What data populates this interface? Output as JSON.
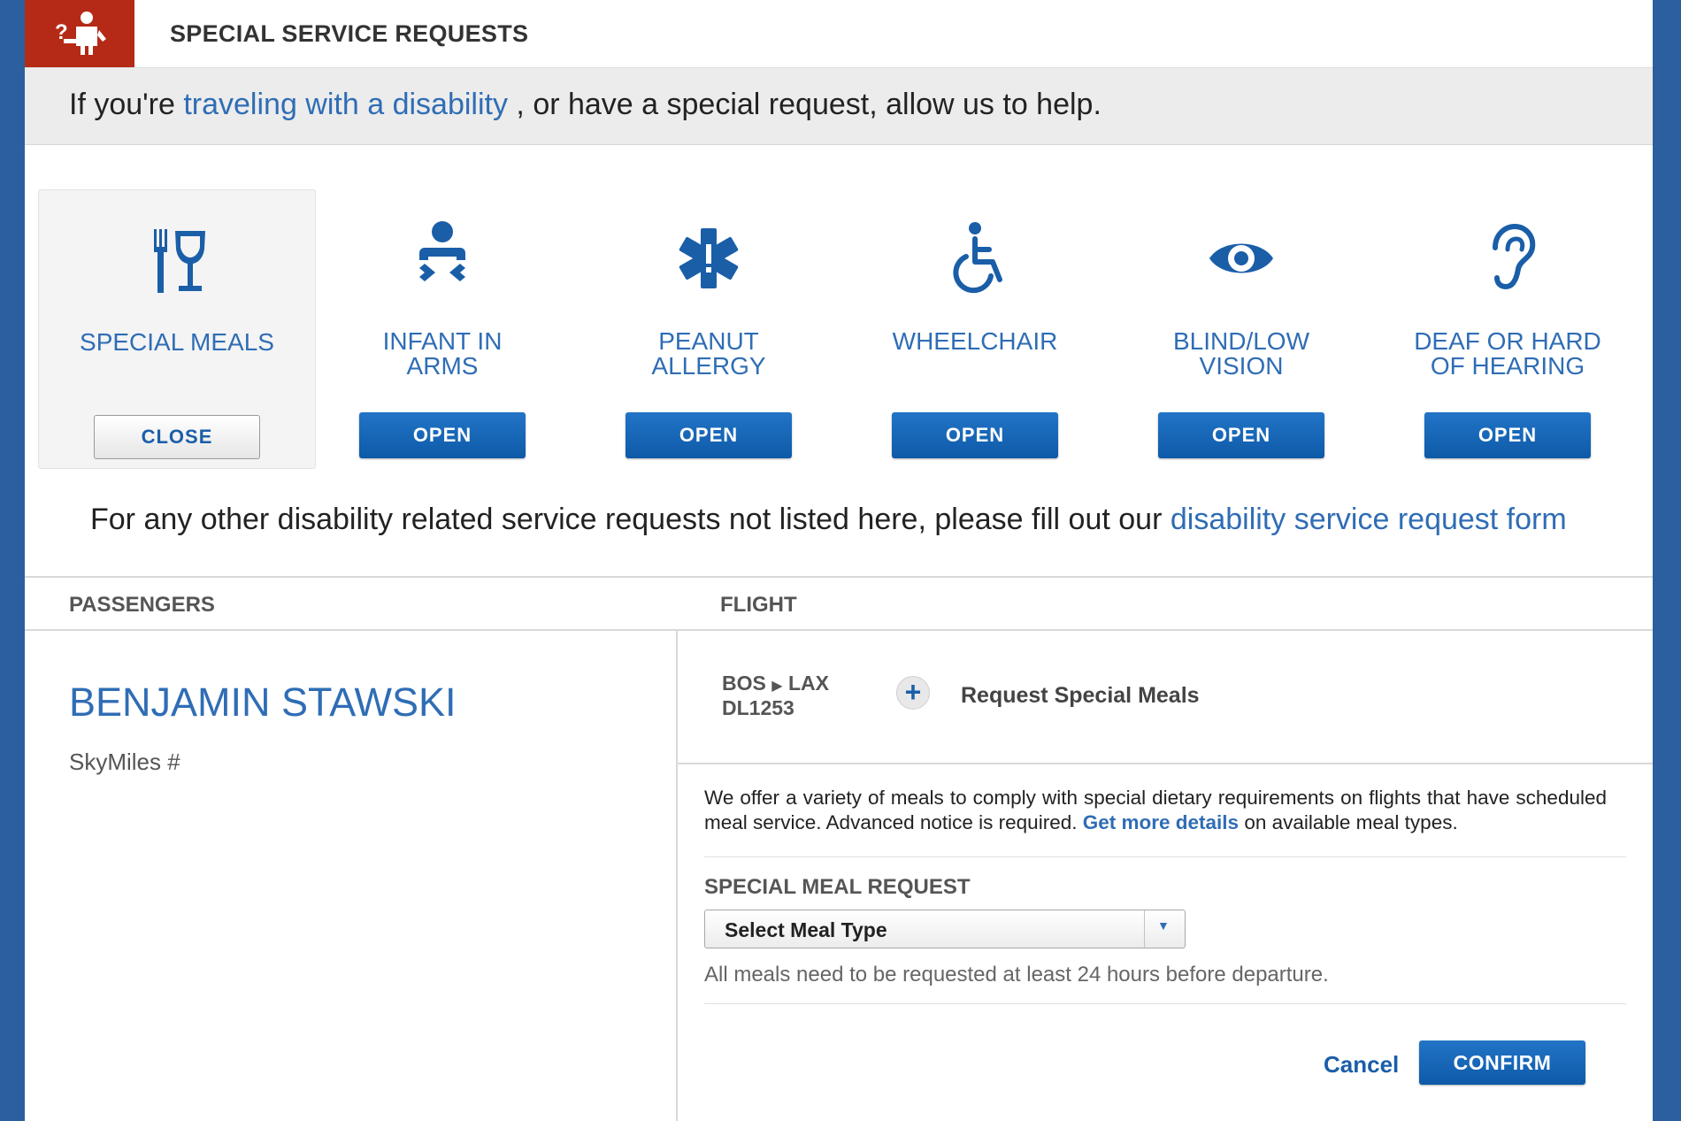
{
  "header": {
    "title": "SPECIAL SERVICE REQUESTS",
    "icon": "person-question-icon"
  },
  "banner": {
    "prefix": "If you're",
    "link": "traveling with a disability",
    "suffix": ", or have a special request, allow us to help."
  },
  "services": [
    {
      "label_lines": [
        "SPECIAL MEALS"
      ],
      "button": "CLOSE",
      "icon": "fork-glass-icon",
      "active": true
    },
    {
      "label_lines": [
        "INFANT IN",
        "ARMS"
      ],
      "button": "OPEN",
      "icon": "infant-icon",
      "active": false
    },
    {
      "label_lines": [
        "PEANUT",
        "ALLERGY"
      ],
      "button": "OPEN",
      "icon": "medical-star-icon",
      "active": false
    },
    {
      "label_lines": [
        "WHEELCHAIR"
      ],
      "button": "OPEN",
      "icon": "wheelchair-icon",
      "active": false
    },
    {
      "label_lines": [
        "BLIND/LOW",
        "VISION"
      ],
      "button": "OPEN",
      "icon": "eye-icon",
      "active": false
    },
    {
      "label_lines": [
        "DEAF OR HARD",
        "OF HEARING"
      ],
      "button": "OPEN",
      "icon": "ear-icon",
      "active": false
    }
  ],
  "other_requests": {
    "text": "For any other disability related service requests not listed here, please fill out our",
    "link": "disability service request form"
  },
  "table": {
    "passengers_header": "PASSENGERS",
    "flight_header": "FLIGHT"
  },
  "passenger": {
    "name": "BENJAMIN STAWSKI",
    "skymiles": "SkyMiles #"
  },
  "flight": {
    "origin": "BOS",
    "destination": "LAX",
    "number": "DL1253",
    "request_label": "Request Special Meals"
  },
  "meal_panel": {
    "description": "We offer a variety of meals to comply with special dietary requirements on flights that have scheduled meal service. Advanced notice is required.",
    "details_link": "Get more details",
    "description_suffix": "on available meal types.",
    "section_label": "SPECIAL MEAL REQUEST",
    "select_value": "Select Meal Type",
    "note": "All meals need to be requested at least 24 hours before departure.",
    "cancel_label": "Cancel",
    "confirm_label": "CONFIRM"
  },
  "colors": {
    "accent_blue": "#2f6db5",
    "button_blue": "#0e5aa8",
    "header_red": "#b42a16",
    "page_bg": "#2c5f9e"
  }
}
